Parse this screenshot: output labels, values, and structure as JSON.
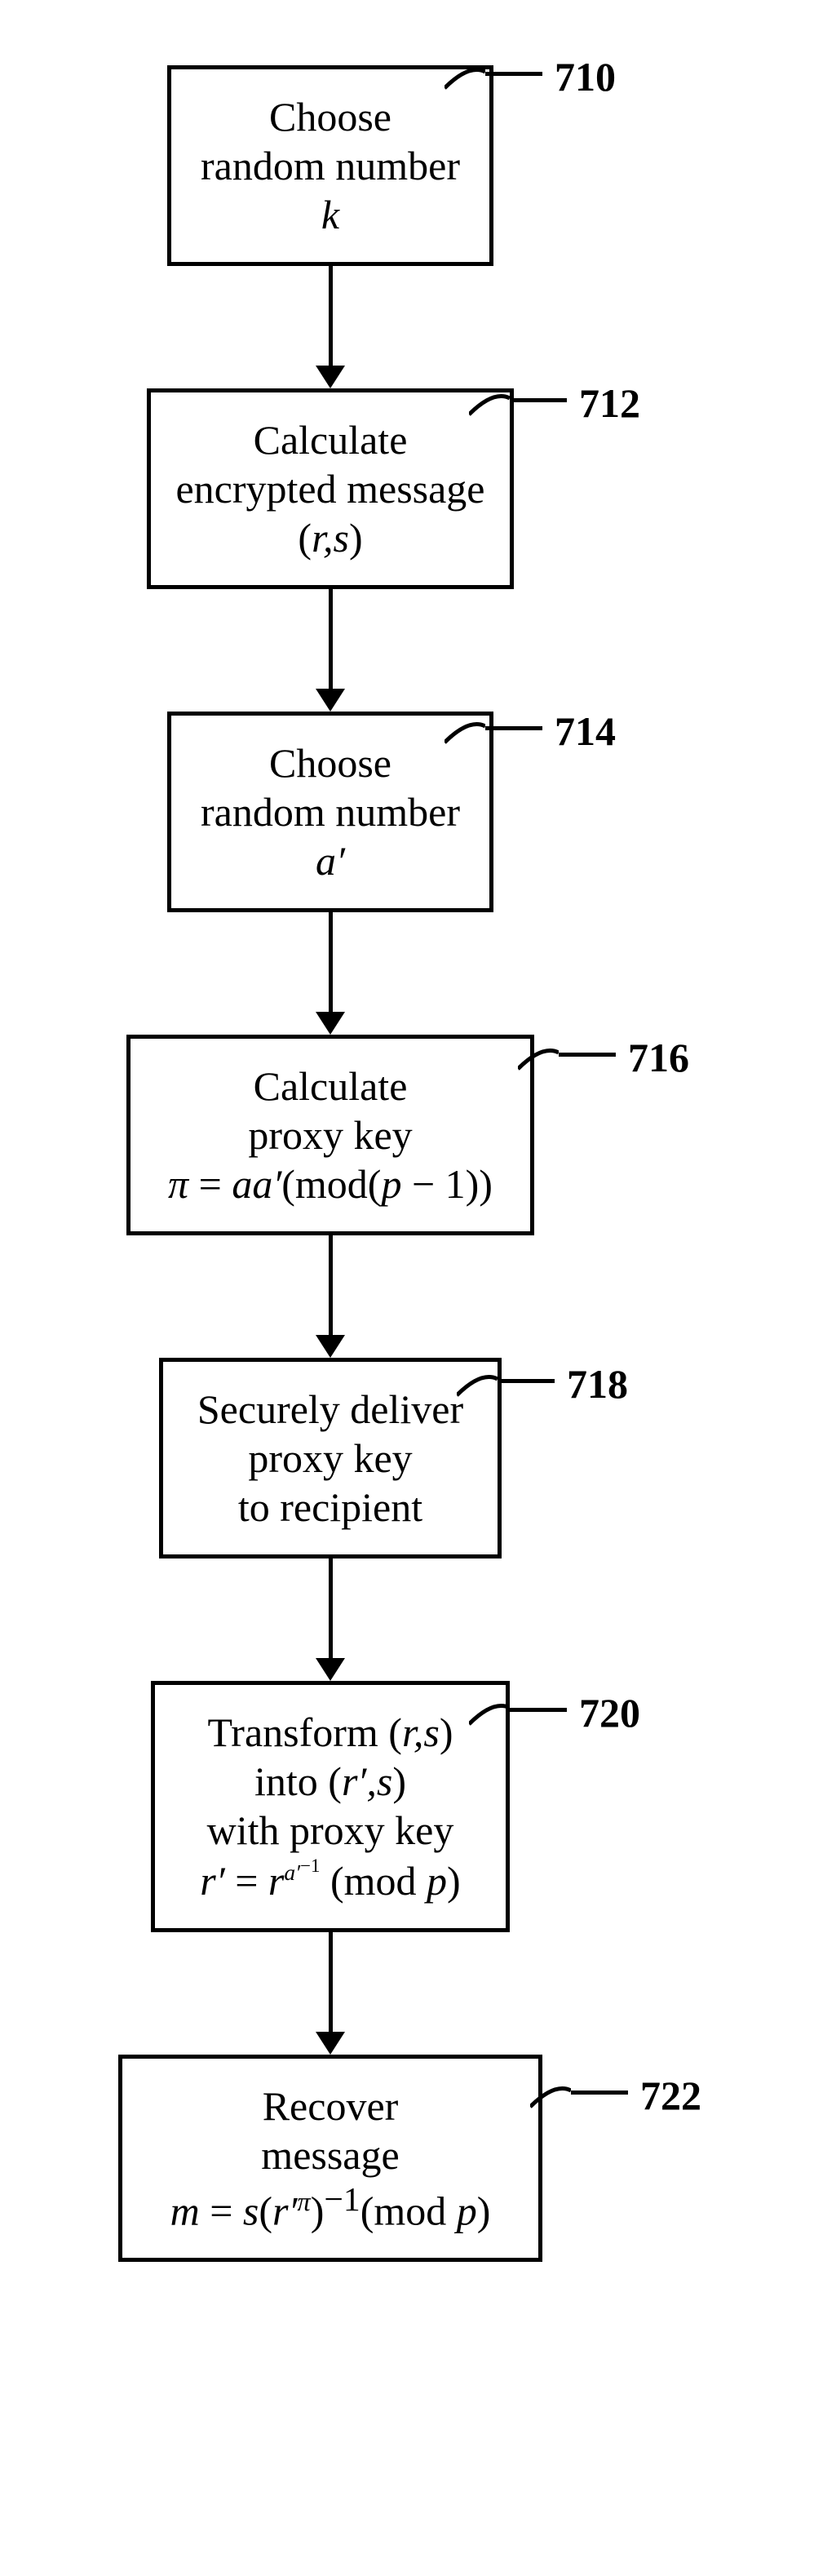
{
  "steps": [
    {
      "id": "710",
      "lines": [
        "Choose",
        "random number"
      ],
      "extra": "k"
    },
    {
      "id": "712",
      "lines": [
        "Calculate",
        "encrypted message"
      ],
      "tuple": "r,s"
    },
    {
      "id": "714",
      "lines": [
        "Choose",
        "random number"
      ],
      "extra": "a′"
    },
    {
      "id": "716",
      "lines": [
        "Calculate",
        "proxy key"
      ],
      "formula_pi": "π = a·a′ (mod (p − 1))"
    },
    {
      "id": "718",
      "lines": [
        "Securely deliver",
        "proxy key",
        "to recipient"
      ]
    },
    {
      "id": "720",
      "lines_tuple": {
        "prefix": "Transform (",
        "t1": "r,s",
        "mid": ")"
      },
      "lines_tuple2": {
        "prefix": "into (",
        "t2": "r′,s",
        "mid": ")"
      },
      "line3": "with proxy key",
      "formula_r": "r′ = r^{a′⁻¹} (mod p)"
    },
    {
      "id": "722",
      "lines": [
        "Recover",
        "message"
      ],
      "formula_m": "m = s (r′^π)⁻¹ (mod p)"
    }
  ],
  "labels": {
    "s710": "710",
    "s712": "712",
    "s714": "714",
    "s716": "716",
    "s718": "718",
    "s720": "720",
    "s722": "722"
  }
}
